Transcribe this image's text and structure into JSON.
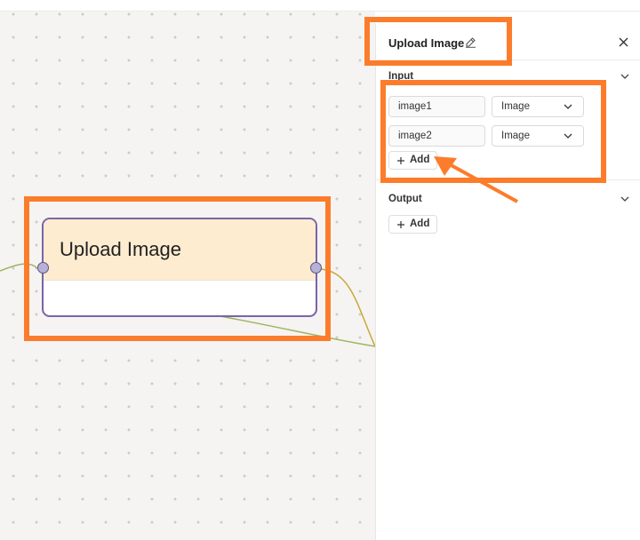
{
  "node": {
    "title": "Upload Image",
    "header_color": "#fdecd0",
    "border_color": "#7b63a8"
  },
  "panel": {
    "title": "Upload Image",
    "edit_icon": "edit-icon",
    "close_icon": "close-icon",
    "input": {
      "label": "Input",
      "rows": [
        {
          "name": "image1",
          "type": "Image"
        },
        {
          "name": "image2",
          "type": "Image"
        }
      ],
      "add_label": "Add"
    },
    "output": {
      "label": "Output",
      "add_label": "Add"
    }
  },
  "colors": {
    "highlight": "#fc7c2b",
    "canvas_bg": "#f5f4f2",
    "edge_green": "#9db560",
    "edge_yellow": "#c9a83b"
  }
}
